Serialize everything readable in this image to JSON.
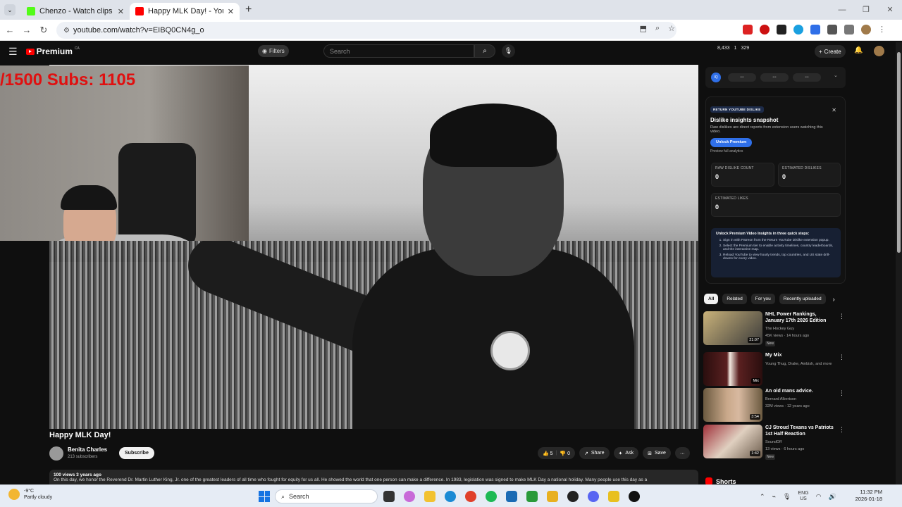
{
  "browser": {
    "tabs": [
      {
        "title": "Chenzo - Watch clips on Kick",
        "favicon_color": "#53fc18"
      },
      {
        "title": "Happy MLK Day! - YouTube",
        "favicon_color": "#ff0000"
      }
    ],
    "url": "youtube.com/watch?v=EIBQ0CN4g_o"
  },
  "youtube": {
    "logo_text": "Premium",
    "logo_region": "CA",
    "filters_label": "Filters",
    "search_placeholder": "Search",
    "header_stats": {
      "views": "8,433",
      "likes": "1",
      "comments": "329"
    },
    "create_label": "Create"
  },
  "stream_overlay": {
    "text": "/1500  Subs: 1105",
    "color": "#e01010"
  },
  "video": {
    "title": "Happy MLK Day!",
    "channel": "Benita Charles",
    "subscribers": "213 subscribers",
    "subscribe_label": "Subscribe",
    "likes": "5",
    "dislikes": "0",
    "share_label": "Share",
    "ask_label": "Ask",
    "save_label": "Save",
    "views_age": "100 views  3 years ago",
    "description": "On this day, we honor the Reverend Dr. Martin Luther King, Jr. one of the greatest leaders of all time who fought for equity for us all. He showed the world that one person can make a difference. In 1983, legislation was signed to make MLK Day a national holiday. Many people use this day as a"
  },
  "dislike_panel": {
    "badge": "RETURN YOUTUBE DISLIKE",
    "title": "Dislike insights snapshot",
    "text": "Raw dislikes are direct reports from extension users watching this video.",
    "button": "Unlock Premium",
    "sub": "Preview full analytics",
    "boxes": [
      {
        "label": "RAW DISLIKE COUNT",
        "value": "0"
      },
      {
        "label": "ESTIMATED DISLIKES",
        "value": "0"
      },
      {
        "label": "ESTIMATED LIKES",
        "value": "0"
      }
    ],
    "steps_title": "Unlock Premium Video Insights in three quick steps:",
    "steps": [
      "Sign in with Patreon from the Return YouTube Dislike extension popup.",
      "Select the Premium tier to enable activity timelines, country leaderboards, and the interactive map.",
      "Reload YouTube to view hourly trends, top countries, and US state drill-downs for every video."
    ]
  },
  "chips": [
    "All",
    "Related",
    "For you",
    "Recently uploaded"
  ],
  "recommendations": [
    {
      "title": "NHL Power Rankings, January 17th 2026 Edition",
      "channel": "The Hockey Guy",
      "meta": "45K views · 14 hours ago",
      "badge": "New",
      "duration": "21:07",
      "thumb": "#6a6048"
    },
    {
      "title": "My Mix",
      "channel": "Young Thug, Drake, Ambish, and more",
      "meta": "",
      "badge": "",
      "duration": "Mix",
      "thumb": "#3a1a1a"
    },
    {
      "title": "An old mans advice.",
      "channel": "Bernard Albertson",
      "meta": "32M views · 12 years ago",
      "badge": "",
      "duration": "3:54",
      "thumb": "#8a6a50"
    },
    {
      "title": "CJ Stroud Texans vs Patriots 1st Half Reaction",
      "channel": "SoundOff",
      "meta": "13 views · 6 hours ago",
      "badge": "New",
      "duration": "1:42",
      "thumb": "#7a6a5a"
    }
  ],
  "shorts_label": "Shorts",
  "taskbar": {
    "temp": "-9°C",
    "weather": "Partly cloudy",
    "search": "Search",
    "lang": "ENG",
    "region": "US",
    "time": "11:32 PM",
    "date": "2026-01-18"
  }
}
